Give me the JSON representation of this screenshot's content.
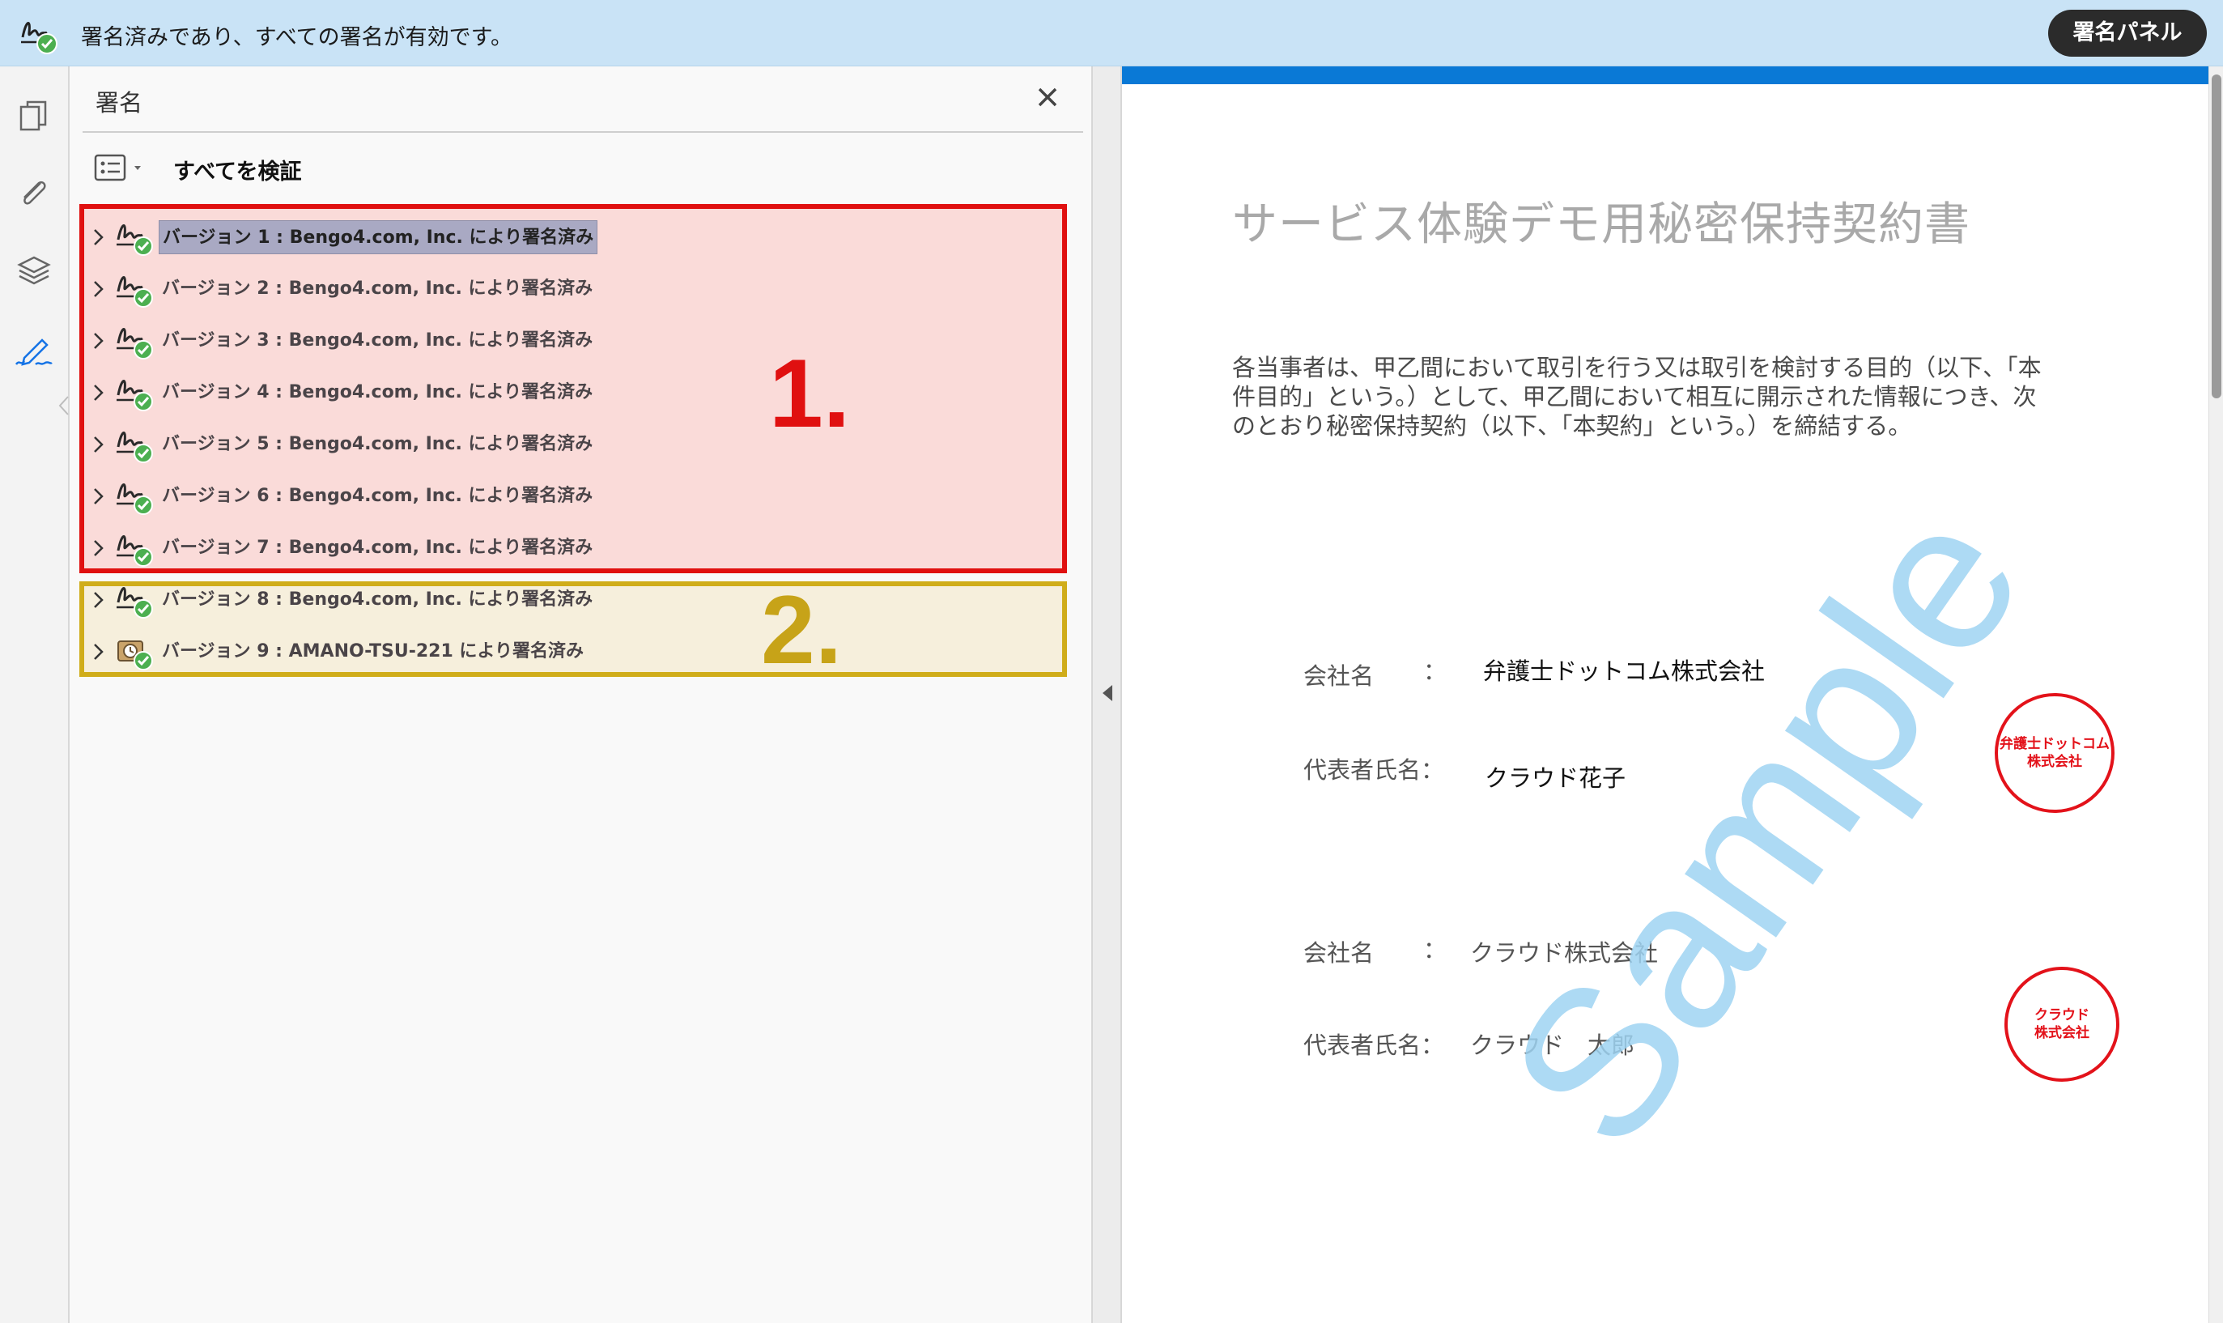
{
  "topbar": {
    "status_icon": "signature-valid-icon",
    "status_text": "署名済みであり、すべての署名が有効です。",
    "panel_button_label": "署名パネル"
  },
  "rail": {
    "items": [
      {
        "icon": "pages-icon"
      },
      {
        "icon": "attachment-icon"
      },
      {
        "icon": "layers-icon"
      },
      {
        "icon": "signature-pen-icon",
        "active": true
      }
    ]
  },
  "sigpanel": {
    "title": "署名",
    "verify_all_label": "すべてを検証",
    "group1_label": "1.",
    "group2_label": "2.",
    "signatures": [
      {
        "label": "バージョン 1 : Bengo4.com, Inc. により署名済み",
        "icon": "signature-valid-icon",
        "selected": true
      },
      {
        "label": "バージョン 2 : Bengo4.com, Inc. により署名済み",
        "icon": "signature-valid-icon"
      },
      {
        "label": "バージョン 3 : Bengo4.com, Inc. により署名済み",
        "icon": "signature-valid-icon"
      },
      {
        "label": "バージョン 4 : Bengo4.com, Inc. により署名済み",
        "icon": "signature-valid-icon"
      },
      {
        "label": "バージョン 5 : Bengo4.com, Inc. により署名済み",
        "icon": "signature-valid-icon"
      },
      {
        "label": "バージョン 6 : Bengo4.com, Inc. により署名済み",
        "icon": "signature-valid-icon"
      },
      {
        "label": "バージョン 7 : Bengo4.com, Inc. により署名済み",
        "icon": "signature-valid-icon"
      },
      {
        "label": "バージョン 8 : Bengo4.com, Inc. により署名済み",
        "icon": "signature-valid-icon"
      },
      {
        "label": "バージョン 9 : AMANO-TSU-221 により署名済み",
        "icon": "timestamp-signature-icon"
      }
    ]
  },
  "document": {
    "title": "サービス体験デモ用秘密保持契約書",
    "paragraph_lines": [
      "各当事者は、甲乙間において取引を行う又は取引を検討する目的（以下、「本",
      "件目的」という。）として、甲乙間において相互に開示された情報につき、次",
      "のとおり秘密保持契約（以下、「本契約」という。）を締結する。"
    ],
    "party1": {
      "company_label": "会社名",
      "company_colon": "：",
      "company_value": "弁護士ドットコム株式会社",
      "rep_label": "代表者氏名：",
      "rep_value": "クラウド花子",
      "stamp_line1": "弁護士ドットコム",
      "stamp_line2": "株式会社"
    },
    "party2": {
      "company_label": "会社名",
      "company_colon": "：",
      "company_value": "クラウド株式会社",
      "rep_label": "代表者氏名：",
      "rep_value": "クラウド　太郎",
      "stamp_line1": "クラウド",
      "stamp_line2": "株式会社"
    },
    "watermark_text": "Sample",
    "colors": {
      "watermark": "#9fd4f2",
      "stamp": "#e3121a",
      "accent": "#0a79d6"
    }
  }
}
